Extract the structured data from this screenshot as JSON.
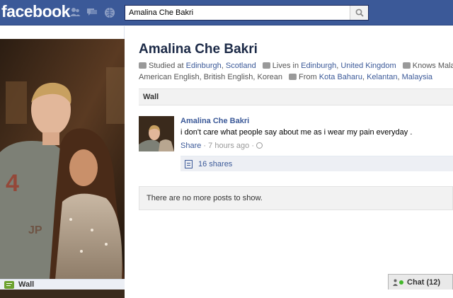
{
  "topbar": {
    "logo": "facebook",
    "search_value": "Amalina Che Bakri",
    "brand_color": "#3b5998"
  },
  "profile": {
    "name": "Amalina Che Bakri",
    "studied_prefix": "Studied at",
    "studied_city": "Edinburgh",
    "studied_country": "Scotland",
    "lives_prefix": "Lives in",
    "lives_city": "Edinburgh",
    "lives_country": "United Kingdom",
    "knows_prefix": "Knows Malay,",
    "languages_rest": "American English, British English, Korean",
    "from_prefix": "From",
    "from_city": "Kota Baharu",
    "from_region": "Kelantan",
    "from_country": "Malaysia"
  },
  "wall": {
    "header": "Wall",
    "left_label": "Wall"
  },
  "post": {
    "author": "Amalina Che Bakri",
    "text": "i don't care what people say about me as i wear my pain everyday .",
    "share_label": "Share",
    "time": "7 hours ago",
    "shares": "16 shares"
  },
  "no_more": "There are no more posts to show.",
  "chat": {
    "label": "Chat",
    "count": "(12)"
  },
  "icons": {
    "search": "search-icon",
    "friends": "friend-requests-icon",
    "messages": "messages-icon",
    "notifications": "notifications-icon",
    "education": "education-icon",
    "home": "home-icon",
    "languages": "globe-icon",
    "from": "house-icon",
    "privacy": "public-globe-icon",
    "shares": "shares-icon",
    "chat": "chat-status-icon"
  }
}
